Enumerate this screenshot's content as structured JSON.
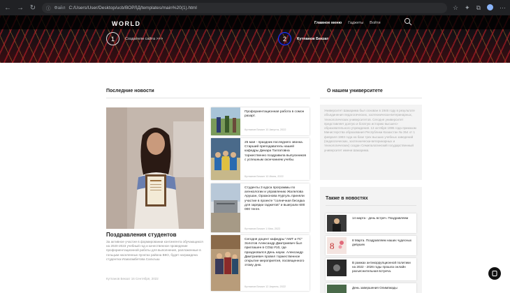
{
  "browser": {
    "url_info": "Файл",
    "url": "C:/Users/User/Desktop/ucb/ВОРЛД/templates/main%20(1).html"
  },
  "site": {
    "logo": "WORLD",
    "nav": [
      "Главное меню",
      "Гаджеты",
      "Войти"
    ],
    "slides": [
      {
        "number": "1",
        "caption": "Создатели сайта >>>"
      },
      {
        "number": "2",
        "caption": "Кутпанов Бекзат"
      }
    ]
  },
  "news": {
    "heading": "Последние новости",
    "feature": {
      "title": "Поздравления студентов",
      "text": "За активное участие в формировании контингента обучающихся на 2020-2023 учебный год и качественное проведение профориентационной работы для выполнения, рапложенные в гольцым населенных пунктах района ВКО, будет награждена студентка Исмагамбетова Сальтыш",
      "meta": "Кутпанов Бекзат 16 Сентября, 2022"
    },
    "items": [
      {
        "title": "Профориентационная работа в сомон разарт.",
        "meta": "Кутпанов Бекзат 10 Августа, 2022"
      },
      {
        "title": "25 мая - праздник последнего звонка. Старший преподаватель нашей кафедры Динара Талгатовна торжественно поздравила выпускников с успешным окончанием учебы.",
        "meta": "Кутпанов Бекзат 10 Июня, 2022"
      },
      {
        "title": "Студенты 3 курса программы по агенкологии и управлению Жалелова Арушан, Оразконова Нургуль приняли участие в проекте \"солнечная беседка для зарядки гаджетов\" и выиграли 600 000 тенге.",
        "meta": "Кутпанов Бекзат 1 Мая, 2022"
      },
      {
        "title": "Сегодня доцент кафедры \"АМТ и ГС\" Золотов Александр Дмитриевич был приглашен в СОШ #10, где праздновался День науки. Александр Дмитриевич провел торжественное открытие мероприятия, посвященного этому дню.",
        "meta": "Кутпанов Бекзат 12 Апреля, 2022"
      }
    ]
  },
  "about": {
    "heading": "О нашем университете",
    "text": "Университет Шакарима был основан в 1946 году в результате объединения педагогических, зоотехнически-ветеринарных, технологических университетов. Сегодня университет представляет долгую и богатую историю высшего-образовательного учреждения. 13 октября 1995 года приказом Министерства образования Республики Казахстан № 354 от 1 февраля 1993 года на базе трех высших учебных заведений (педагогических, зоотехнически-ветеринарных и технологических) создан Семипалатинский государственный университет имени Шакарима."
  },
  "also": {
    "heading": "Также в новостях",
    "items": [
      {
        "title": "14 марта - день встреч. Поздравляем"
      },
      {
        "title": "8 Марта. Поздравляем наших чудесных девушек"
      },
      {
        "title": "В рамках антикоррупционной политики на 2022 - 2026 годы прошла онлайн разъяснительная встреча."
      },
      {
        "title": "День завершения Олимпиады"
      }
    ]
  },
  "colors": {
    "accent": "#1e3cff",
    "header_bg": "#0a0a0c"
  }
}
